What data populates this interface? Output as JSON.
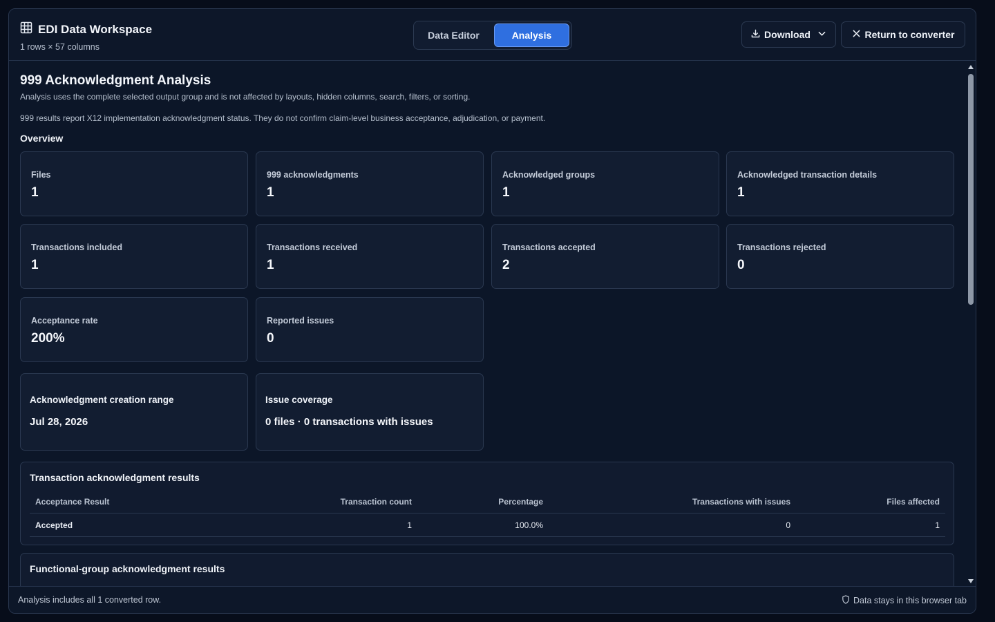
{
  "header": {
    "app_title": "EDI Data Workspace",
    "subtitle": "1 rows × 57 columns",
    "tabs": [
      {
        "label": "Data Editor",
        "active": false
      },
      {
        "label": "Analysis",
        "active": true
      }
    ],
    "download_label": "Download",
    "return_label": "Return to converter",
    "icons": {
      "app": "grid-table-icon",
      "download": "download-icon",
      "chevron": "chevron-down-icon",
      "close": "close-icon"
    },
    "accent_color": "#2f6fe0"
  },
  "analysis": {
    "title": "999 Acknowledgment Analysis",
    "description": "Analysis uses the complete selected output group and is not affected by layouts, hidden columns, search, filters, or sorting.",
    "note": "999 results report X12 implementation acknowledgment status. They do not confirm claim-level business acceptance, adjudication, or payment.",
    "overview_label": "Overview",
    "cards": [
      {
        "label": "Files",
        "value": "1"
      },
      {
        "label": "999 acknowledgments",
        "value": "1"
      },
      {
        "label": "Acknowledged groups",
        "value": "1"
      },
      {
        "label": "Acknowledged transaction details",
        "value": "1"
      },
      {
        "label": "Transactions included",
        "value": "1"
      },
      {
        "label": "Transactions received",
        "value": "1"
      },
      {
        "label": "Transactions accepted",
        "value": "2"
      },
      {
        "label": "Transactions rejected",
        "value": "0"
      },
      {
        "label": "Acceptance rate",
        "value": "200%"
      },
      {
        "label": "Reported issues",
        "value": "0"
      }
    ],
    "wide_cards": [
      {
        "label": "Acknowledgment creation range",
        "value": "Jul 28, 2026"
      },
      {
        "label": "Issue coverage",
        "value": "0 files · 0 transactions with issues"
      }
    ],
    "transaction_table": {
      "title": "Transaction acknowledgment results",
      "columns": [
        "Acceptance Result",
        "Transaction count",
        "Percentage",
        "Transactions with issues",
        "Files affected"
      ],
      "rows": [
        [
          "Accepted",
          "1",
          "100.0%",
          "0",
          "1"
        ]
      ]
    },
    "group_table": {
      "title": "Functional-group acknowledgment results"
    }
  },
  "footer": {
    "left_text": "Analysis includes all 1 converted row.",
    "right_text": "Data stays in this browser tab",
    "right_icon": "shield-icon"
  }
}
